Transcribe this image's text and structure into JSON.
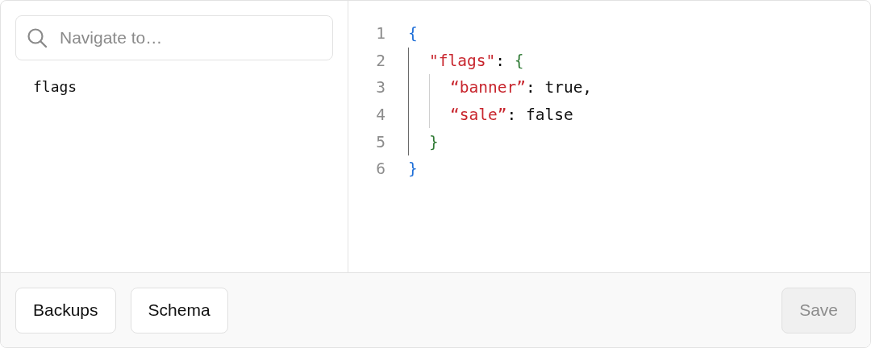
{
  "navigator": {
    "search": {
      "placeholder": "Navigate to…"
    },
    "items": [
      {
        "label": "flags",
        "selected": false
      }
    ]
  },
  "editor": {
    "lines": [
      {
        "number": "1",
        "tokens": [
          {
            "kind": "brace-outer",
            "text": "{"
          }
        ]
      },
      {
        "number": "2",
        "tokens": [
          {
            "kind": "guide-active"
          },
          {
            "kind": "key",
            "text": "\"flags\""
          },
          {
            "kind": "punct",
            "text": ": "
          },
          {
            "kind": "brace-inner",
            "text": "{"
          }
        ]
      },
      {
        "number": "3",
        "tokens": [
          {
            "kind": "guide-active"
          },
          {
            "kind": "guide"
          },
          {
            "kind": "key",
            "text": "“banner”"
          },
          {
            "kind": "punct",
            "text": ": "
          },
          {
            "kind": "value",
            "text": "true,"
          }
        ]
      },
      {
        "number": "4",
        "tokens": [
          {
            "kind": "guide-active"
          },
          {
            "kind": "guide"
          },
          {
            "kind": "key",
            "text": "“sale”"
          },
          {
            "kind": "punct",
            "text": ": "
          },
          {
            "kind": "value",
            "text": "false"
          }
        ]
      },
      {
        "number": "5",
        "tokens": [
          {
            "kind": "guide-active"
          },
          {
            "kind": "brace-inner",
            "text": "}"
          }
        ]
      },
      {
        "number": "6",
        "tokens": [
          {
            "kind": "brace-outer",
            "text": "}"
          }
        ]
      }
    ]
  },
  "footer": {
    "buttons": [
      {
        "label": "Backups",
        "disabled": false
      },
      {
        "label": "Schema",
        "disabled": false
      }
    ],
    "save": {
      "label": "Save",
      "disabled": true
    }
  }
}
